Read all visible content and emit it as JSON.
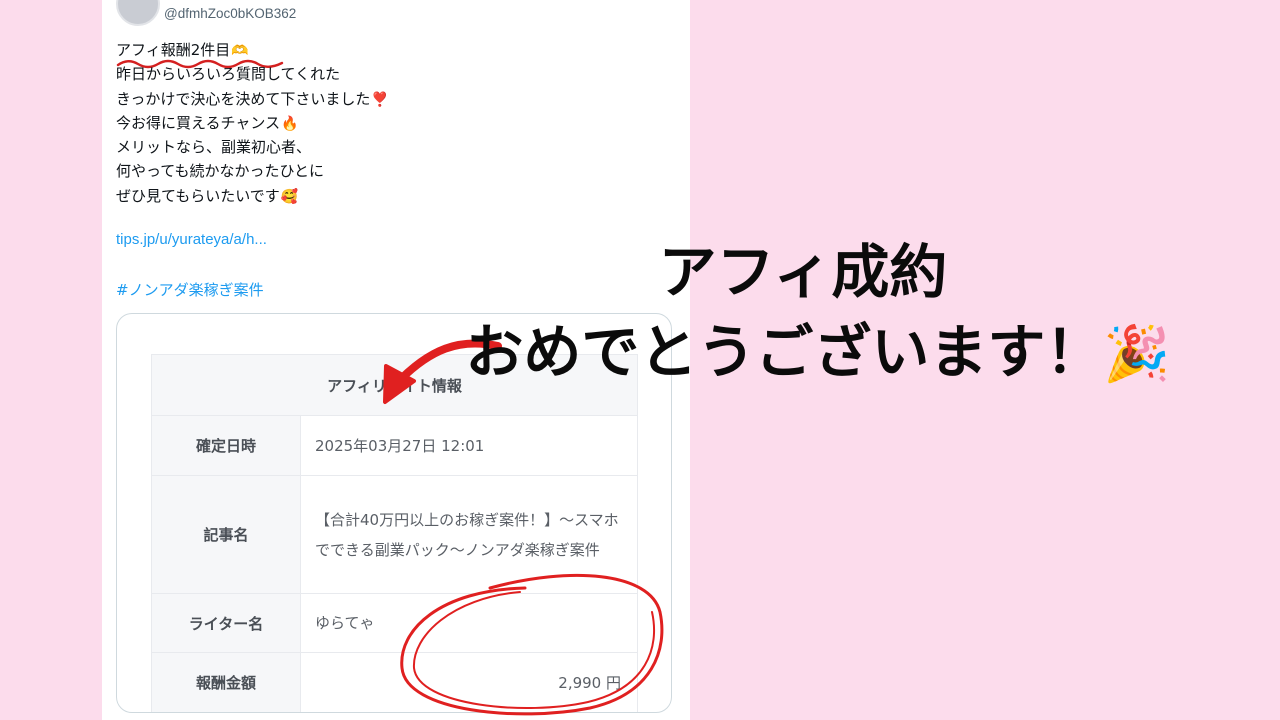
{
  "tweet": {
    "handle": "@dfmhZoc0bKOB362",
    "lines": [
      {
        "text": "アフィ報酬2件目",
        "emoji": "🫶"
      },
      {
        "text": "昨日からいろいろ質問してくれた",
        "emoji": ""
      },
      {
        "text": "きっかけで決心を決めて下さいました",
        "emoji": "❣️"
      },
      {
        "text": "今お得に買えるチャンス",
        "emoji": "🔥"
      },
      {
        "text": "メリットなら、副業初心者、",
        "emoji": ""
      },
      {
        "text": "何やっても続かなかったひとに",
        "emoji": ""
      },
      {
        "text": "ぜひ見てもらいたいです",
        "emoji": "🥰"
      }
    ],
    "link": "tips.jp/u/yurateya/a/h...",
    "hashtag": "#ノンアダ楽稼ぎ案件"
  },
  "affiliate_table": {
    "header": "アフィリエイト情報",
    "rows": [
      {
        "label": "確定日時",
        "value": "2025年03月27日 12:01"
      },
      {
        "label": "記事名",
        "value": "【合計40万円以上のお稼ぎ案件！】〜スマホでできる副業パック〜ノンアダ楽稼ぎ案件"
      },
      {
        "label": "ライター名",
        "value": "ゆらてゃ"
      },
      {
        "label": "報酬金額",
        "value": "2,990 円"
      }
    ]
  },
  "headline": {
    "line1": "アフィ成約",
    "line2": "おめでとうございます！",
    "emoji": "🎉"
  },
  "colors": {
    "background": "#fcdcec",
    "link": "#1d9bf0",
    "annotation_red": "#e02020"
  }
}
